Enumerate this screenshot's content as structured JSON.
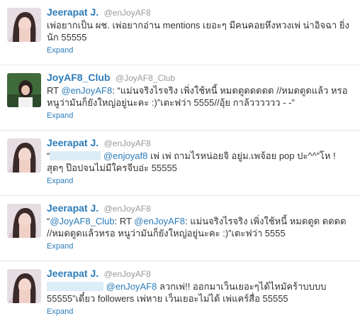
{
  "tweets": [
    {
      "name": "Jeerapat J.",
      "handle": "@enJoyAF8",
      "avatar": "avatar-girl-photo",
      "text1": "เพ่อยากเป็น ผช. เพ่อยากอ่าน mentions เยอะๆ มีคนคอยหึงหวงเพ่ น่าอิจฉา ยิ่งนัก 55555",
      "expand": "Expand"
    },
    {
      "name": "JoyAF8_Club",
      "handle": "@JoyAF8_Club",
      "avatar": "avatar-club-photo",
      "prefix": "RT ",
      "mention": "@enJoyAF8",
      "text1": ": “แม่นจริงไรจริง เพิ่งใช้หนี้ หมดตูดดดดด //หมดตูดแล้ว หรอ หนูว่ามันก็ยังใหญ่อยู่นะคะ :)”เตะฟว่า 5555//อุ้ย กาล้วววววว - -”",
      "expand": "Expand"
    },
    {
      "name": "Jeerapat J.",
      "handle": "@enJoyAF8",
      "avatar": "avatar-girl-photo",
      "prefix": "“",
      "mention": "@enjoyaf8",
      "text1": " เพ่ เพ่ ถามไรหน่อยจิ อยู่ม.เพจ้อย pop ปะ^^”โห ! สุดๆ ป๊อปจนไม่มีใครจีบอ่ะ 55555",
      "expand": "Expand"
    },
    {
      "name": "Jeerapat J.",
      "handle": "@enJoyAF8",
      "avatar": "avatar-girl-photo",
      "prefix": "“",
      "mention": "@JoyAF8_Club",
      "mid": ": RT ",
      "mention2": "@enJoyAF8",
      "text1": ": แม่นจริงไรจริง เพิ่งใช้หนี้ หมดตูด ดดดด //หมดตูดแล้วหรอ หนูว่ามันก็ยังใหญ่อยู่นะคะ :)”เตะฟว่า 5555",
      "expand": "Expand"
    },
    {
      "name": "Jeerapat J.",
      "handle": "@enJoyAF8",
      "avatar": "avatar-girl-photo",
      "mention": "@enJoyAF8",
      "text1": " ลวกเพ่!! ออกมาเว็นเยอะๆได้ไหมัคร้าบบบบ 55555”เดี๋ยว followers เพ่หาย เว็นเยอะไม่ได้ เพ่แคร์สื่อ 55555",
      "expand": "Expand"
    }
  ]
}
